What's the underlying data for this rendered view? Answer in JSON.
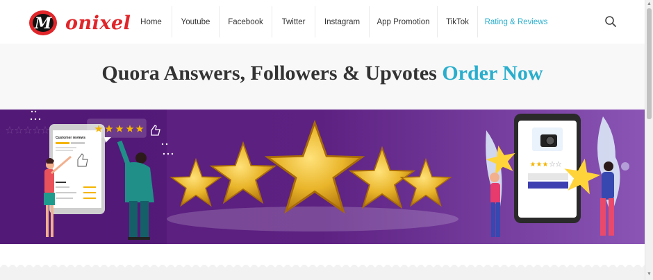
{
  "header": {
    "logo_text": "onixel",
    "logo_letter": "M",
    "nav": [
      {
        "label": "Home",
        "name": "nav-home",
        "active": false
      },
      {
        "label": "Youtube",
        "name": "nav-youtube",
        "active": false
      },
      {
        "label": "Facebook",
        "name": "nav-facebook",
        "active": false
      },
      {
        "label": "Twitter",
        "name": "nav-twitter",
        "active": false
      },
      {
        "label": "Instagram",
        "name": "nav-instagram",
        "active": false
      },
      {
        "label": "App Promotion",
        "name": "nav-app-promotion",
        "active": false
      },
      {
        "label": "TikTok",
        "name": "nav-tiktok",
        "active": false
      },
      {
        "label": "Rating & Reviews",
        "name": "nav-rating-reviews",
        "active": true
      }
    ],
    "search_icon": "search-icon"
  },
  "hero": {
    "title": "Quora Answers, Followers & Upvotes",
    "accent": "Order Now"
  },
  "banner": {
    "review_card_title": "Customer reviews",
    "stars_highlighted": 5
  },
  "colors": {
    "accent": "#29aecd",
    "logo_red": "#e0262a",
    "banner_purple": "#5b1f80",
    "star_gold": "#f4b400"
  }
}
